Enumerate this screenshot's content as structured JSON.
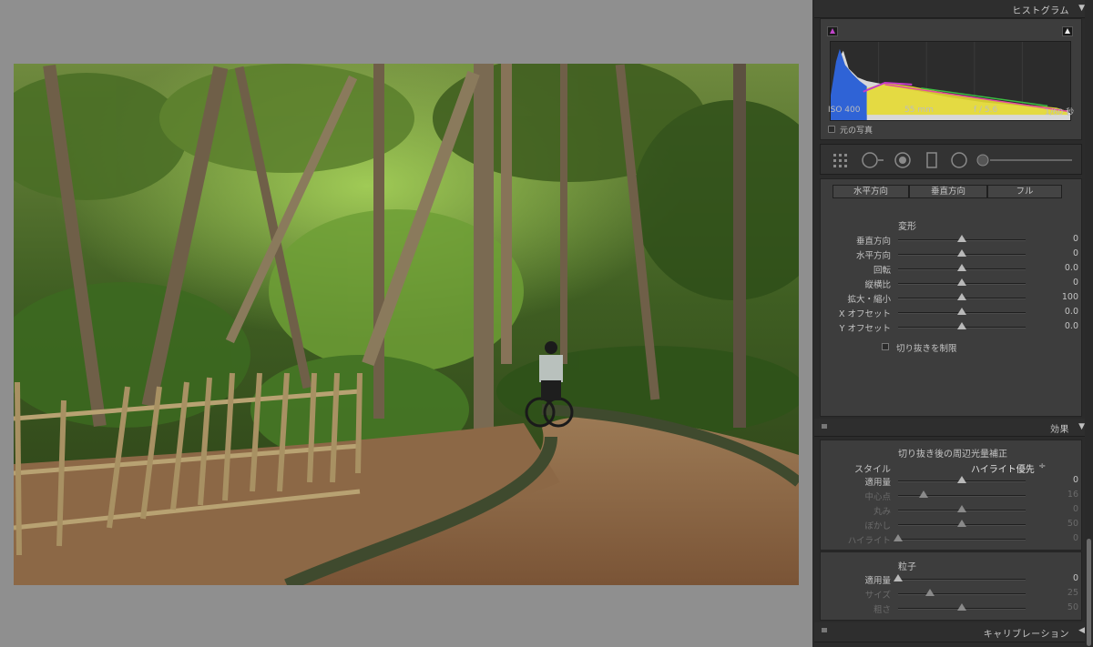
{
  "histogram": {
    "title": "ヒストグラム",
    "iso": "ISO 400",
    "focal": "55 mm",
    "aperture": "f / 5.6",
    "shutter": "1/60 秒",
    "original_photo_label": "元の写真"
  },
  "upright": {
    "buttons": [
      "水平方向",
      "垂直方向",
      "フル"
    ]
  },
  "transform": {
    "title": "変形",
    "sliders": [
      {
        "label": "垂直方向",
        "value": "0",
        "pos": 0.5
      },
      {
        "label": "水平方向",
        "value": "0",
        "pos": 0.5
      },
      {
        "label": "回転",
        "value": "0.0",
        "pos": 0.5
      },
      {
        "label": "縦横比",
        "value": "0",
        "pos": 0.5
      },
      {
        "label": "拡大・縮小",
        "value": "100",
        "pos": 0.5
      },
      {
        "label": "X オフセット",
        "value": "0.0",
        "pos": 0.5
      },
      {
        "label": "Y オフセット",
        "value": "0.0",
        "pos": 0.5
      }
    ],
    "constrain_crop_label": "切り抜きを制限"
  },
  "effects": {
    "title": "効果",
    "vignette_title": "切り抜き後の周辺光量補正",
    "style_label": "スタイル",
    "style_value": "ハイライト優先",
    "style_arrow": "÷",
    "vignette_sliders": [
      {
        "label": "適用量",
        "value": "0",
        "pos": 0.5,
        "dim": false
      },
      {
        "label": "中心点",
        "value": "16",
        "pos": 0.2,
        "dim": true
      },
      {
        "label": "丸み",
        "value": "0",
        "pos": 0.5,
        "dim": true
      },
      {
        "label": "ぼかし",
        "value": "50",
        "pos": 0.5,
        "dim": true
      },
      {
        "label": "ハイライト",
        "value": "0",
        "pos": 0.0,
        "dim": true
      }
    ],
    "grain_title": "粒子",
    "grain_sliders": [
      {
        "label": "適用量",
        "value": "0",
        "pos": 0.0,
        "dim": false
      },
      {
        "label": "サイズ",
        "value": "25",
        "pos": 0.25,
        "dim": true
      },
      {
        "label": "粗さ",
        "value": "50",
        "pos": 0.5,
        "dim": true
      }
    ]
  },
  "calibration": {
    "title": "キャリブレーション"
  },
  "icons": {
    "collapse": "▼",
    "expand": "◀"
  },
  "colors": {
    "panel_bg": "#2b2b2b",
    "section_bg": "#3d3d3d",
    "viewer_bg": "#8f8f8f"
  }
}
